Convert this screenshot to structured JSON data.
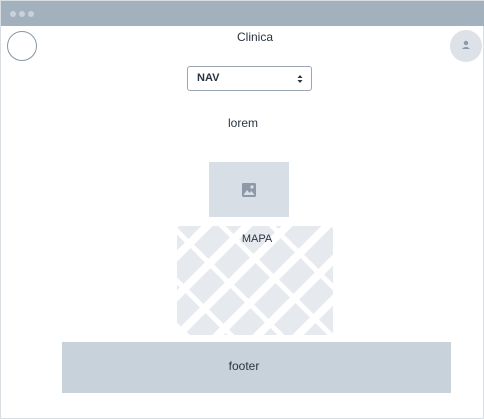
{
  "window": {
    "controls": [
      "window-dot",
      "window-dot",
      "window-dot"
    ]
  },
  "header": {
    "logo_icon": "circle-logo-icon",
    "title": "Clinica",
    "avatar_icon": "user-icon"
  },
  "nav": {
    "selected": "NAV",
    "caret_icon": "updown-caret-icon"
  },
  "main": {
    "text": "lorem",
    "image_icon": "image-icon",
    "map_label": "MAPA"
  },
  "footer": {
    "label": "footer"
  },
  "colors": {
    "titlebar": "#a3b1bf",
    "placeholder": "#d8dee5",
    "map": "#e6e9ee",
    "footer": "#c8d2db"
  }
}
